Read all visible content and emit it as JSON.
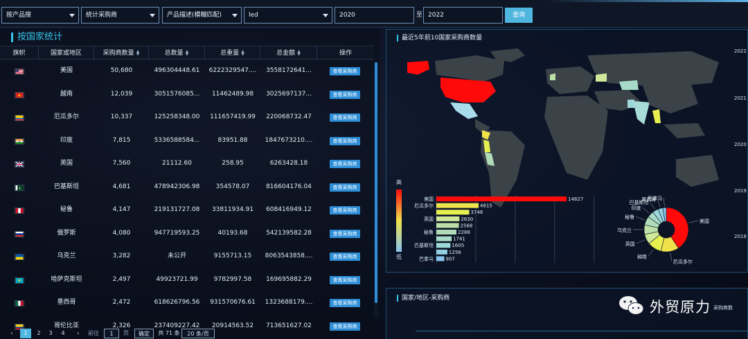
{
  "filters": {
    "search_type": "按产品搜",
    "stat_type": "统计采购商",
    "desc_type": "产品描述(模糊匹配)",
    "keyword": "led",
    "year_from": "2020",
    "to_label": "至",
    "year_to": "2022",
    "query_label": "查询"
  },
  "left_panel": {
    "title": "按国家统计",
    "columns": [
      "旗帜",
      "国家或地区",
      "采购商数量",
      "总数量",
      "总重量",
      "总金额",
      "操作"
    ],
    "action_label": "查看采购商",
    "rows": [
      {
        "country": "美国",
        "buyers": "50,680",
        "qty": "496304448.61",
        "weight": "6222329547....",
        "amount": "3558172641...",
        "flag": "us"
      },
      {
        "country": "越南",
        "buyers": "12,039",
        "qty": "3051576085...",
        "weight": "11462489.98",
        "amount": "3025697137...",
        "flag": "vn"
      },
      {
        "country": "厄瓜多尔",
        "buyers": "10,337",
        "qty": "125258348.00",
        "weight": "111657419.99",
        "amount": "220068732.47",
        "flag": "ec"
      },
      {
        "country": "印度",
        "buyers": "7,815",
        "qty": "5336588584...",
        "weight": "83951.88",
        "amount": "1847673210....",
        "flag": "in"
      },
      {
        "country": "英国",
        "buyers": "7,560",
        "qty": "21112.60",
        "weight": "258.95",
        "amount": "6263428.18",
        "flag": "gb"
      },
      {
        "country": "巴基斯坦",
        "buyers": "4,681",
        "qty": "478942306.98",
        "weight": "354578.07",
        "amount": "816604176.04",
        "flag": "pk"
      },
      {
        "country": "秘鲁",
        "buyers": "4,147",
        "qty": "219131727.08",
        "weight": "33811934.91",
        "amount": "608416949.12",
        "flag": "pe"
      },
      {
        "country": "俄罗斯",
        "buyers": "4,080",
        "qty": "947719593.25",
        "weight": "40193.68",
        "amount": "542139582.28",
        "flag": "ru"
      },
      {
        "country": "乌克兰",
        "buyers": "3,282",
        "qty": "未公开",
        "weight": "9155713.15",
        "amount": "8063543858....",
        "flag": "ua"
      },
      {
        "country": "哈萨克斯坦",
        "buyers": "2,497",
        "qty": "49923721.99",
        "weight": "9782997.58",
        "amount": "169695882.29",
        "flag": "kz"
      },
      {
        "country": "墨西哥",
        "buyers": "2,472",
        "qty": "618626796.56",
        "weight": "931570676.61",
        "amount": "1323688179....",
        "flag": "mx"
      },
      {
        "country": "哥伦比亚",
        "buyers": "2,326",
        "qty": "237409227.42",
        "weight": "20914563.52",
        "amount": "713651627.02",
        "flag": "co"
      }
    ],
    "pager": {
      "pages": [
        "1",
        "2",
        "3",
        "4"
      ],
      "goto_label": "前往",
      "goto_value": "1",
      "page_unit": "页",
      "confirm_label": "确定",
      "total_label": "共 71 条",
      "page_size": "20 条/页"
    }
  },
  "map_panel": {
    "title": "最近5年前10国家采购商数量",
    "legend_high": "高",
    "legend_low": "低",
    "years": [
      "2022",
      "2021",
      "2020",
      "2019",
      "2018"
    ]
  },
  "chart_data": [
    {
      "type": "bar",
      "orientation": "horizontal",
      "categories": [
        "美国",
        "厄瓜多尔",
        "",
        "英国",
        "",
        "秘鲁",
        "",
        "巴基斯坦",
        "",
        "巴拿马"
      ],
      "values": [
        14827,
        4815,
        3746,
        2630,
        2568,
        2288,
        1741,
        1605,
        1256,
        907
      ],
      "colors": [
        "#ff0a0a",
        "#f0e24a",
        "#e8f050",
        "#cfe89a",
        "#bde0a8",
        "#b0dcb8",
        "#a8dcc8",
        "#9cd8d8",
        "#92d0e4",
        "#88c4ee"
      ]
    },
    {
      "type": "pie",
      "labels": [
        "美国",
        "厄瓜多尔",
        "越南",
        "英国",
        "乌克兰",
        "秘鲁",
        "印度",
        "巴基斯坦",
        "墨西哥",
        "巴拿马"
      ],
      "values": [
        14827,
        4815,
        3746,
        2630,
        2568,
        2288,
        1741,
        1605,
        1256,
        907
      ],
      "colors": [
        "#ff0a0a",
        "#f0e24a",
        "#e8f050",
        "#cfe89a",
        "#bde0a8",
        "#b0dcb8",
        "#a8dcc8",
        "#9cd8d8",
        "#92d0e4",
        "#88c4ee"
      ]
    }
  ],
  "bottom_panel": {
    "title": "国家/地区-采购商",
    "legend_label": "采购商数"
  },
  "watermark": "外贸原力"
}
